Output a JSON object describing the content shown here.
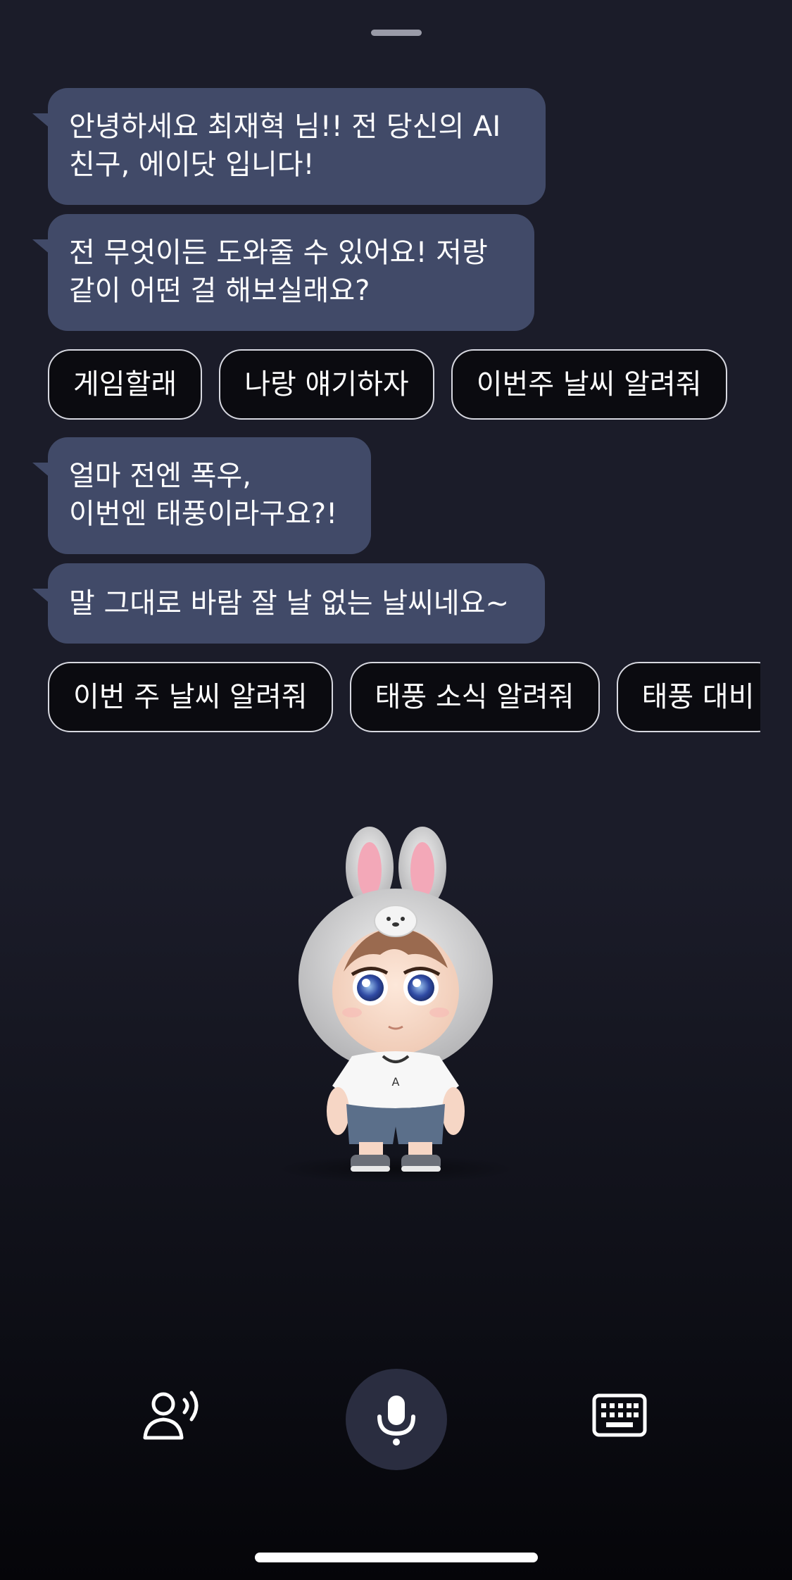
{
  "messages": [
    "안녕하세요 최재혁 님!! 전 당신의 AI 친구, 에이닷 입니다!",
    "전 무엇이든 도와줄 수 있어요! 저랑 같이 어떤 걸 해보실래요?",
    "얼마 전엔 폭우,\n이번엔 태풍이라구요?!",
    "말 그대로 바람 잘 날 없는 날씨네요~"
  ],
  "suggestions_1": [
    "게임할래",
    "나랑 얘기하자",
    "이번주 날씨 알려줘"
  ],
  "suggestions_2": [
    "이번 주 날씨 알려줘",
    "태풍 소식 알려줘",
    "태풍 대비"
  ],
  "bottom_bar": {
    "left_icon": "voice-conversation-icon",
    "center_icon": "microphone-icon",
    "right_icon": "keyboard-icon"
  },
  "colors": {
    "bubble": "#414a68",
    "background": "#1b1c29",
    "mic_button": "#2a2d40"
  }
}
